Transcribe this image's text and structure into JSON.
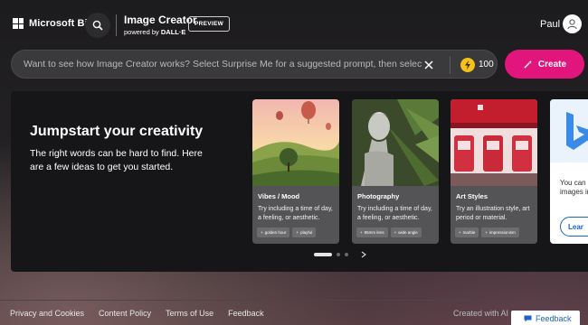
{
  "header": {
    "logo_text": "Microsoft Bing",
    "brand_title": "Image Creator",
    "brand_powered_by": "powered by",
    "brand_powered_name": "DALL·E",
    "preview_badge": "PREVIEW",
    "user_name": "Paul"
  },
  "prompt": {
    "placeholder": "Want to see how Image Creator works? Select Surprise Me for a suggested prompt, then select Create",
    "boost_count": "100",
    "create_label": "Create"
  },
  "panel": {
    "title": "Jumpstart your creativity",
    "description": "The right words can be hard to find. Here are a few ideas to get you started.",
    "cards": [
      {
        "title": "Vibes / Mood",
        "description": "Try including a time of day, a feeling, or aesthetic.",
        "tags": [
          "golden hour",
          "playful"
        ]
      },
      {
        "title": "Photography",
        "description": "Try including a time of day, a feeling, or aesthetic.",
        "tags": [
          "85mm lens",
          "wide angle"
        ]
      },
      {
        "title": "Art Styles",
        "description": "Try an illustration style, art period or material.",
        "tags": [
          "marble",
          "impressionism"
        ]
      }
    ],
    "peek_card": {
      "description": "You can use images in fi",
      "button": "Lear"
    },
    "carousel_page": 1,
    "carousel_total": 3
  },
  "footer": {
    "links": [
      "Privacy and Cookies",
      "Content Policy",
      "Terms of Use",
      "Feedback"
    ],
    "credit": "Created with AI",
    "feedback_button": "Feedback"
  },
  "colors": {
    "create_button": "#e2157d",
    "coin": "#f4c21c",
    "link_blue": "#1a63c8"
  }
}
